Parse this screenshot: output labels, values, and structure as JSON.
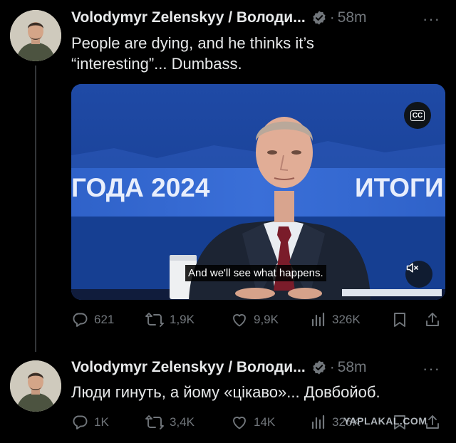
{
  "tweets": [
    {
      "author": "Volodymyr Zelenskyy / Володи...",
      "time": "58m",
      "text_line1": "People are dying, and he thinks it’s",
      "text_line2": "“interesting”... Dumbass.",
      "media": {
        "banner": "ГОДА 2024",
        "banner2": "ИТОГИ Г",
        "cc_label": "CC",
        "subtitle": "And we'll see what happens."
      },
      "replies": "621",
      "reposts": "1,9K",
      "likes": "9,9K",
      "views": "326K"
    },
    {
      "author": "Volodymyr Zelenskyy / Володи...",
      "time": "58m",
      "text_line1": "Люди гинуть, а йому «цікаво»... Довбойоб.",
      "replies": "1K",
      "reposts": "3,4K",
      "likes": "14K",
      "views": "326K"
    }
  ],
  "more_glyph": "···",
  "separator": "·",
  "watermark": "YAPLAKAL.COM",
  "colors": {
    "background": "#000000",
    "text": "#e7e9ea",
    "muted": "#71767b",
    "verified": "#71767b",
    "thread_line": "#333639"
  }
}
